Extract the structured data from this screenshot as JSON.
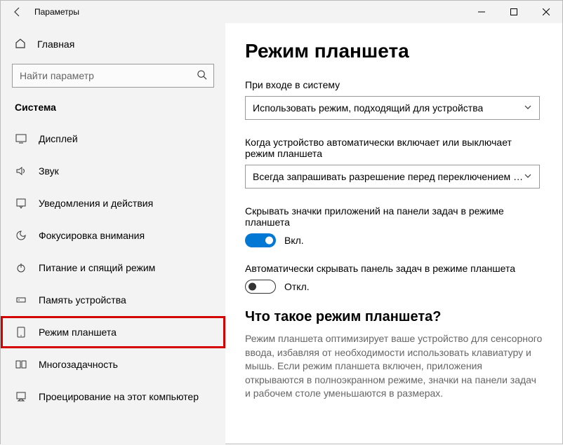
{
  "window": {
    "title": "Параметры"
  },
  "sidebar": {
    "home": "Главная",
    "search_placeholder": "Найти параметр",
    "section": "Система",
    "items": [
      {
        "icon": "display",
        "label": "Дисплей"
      },
      {
        "icon": "sound",
        "label": "Звук"
      },
      {
        "icon": "notifications",
        "label": "Уведомления и действия"
      },
      {
        "icon": "focus",
        "label": "Фокусировка внимания"
      },
      {
        "icon": "power",
        "label": "Питание и спящий режим"
      },
      {
        "icon": "storage",
        "label": "Память устройства"
      },
      {
        "icon": "tablet",
        "label": "Режим планшета",
        "highlighted": true
      },
      {
        "icon": "multitask",
        "label": "Многозадачность"
      },
      {
        "icon": "project",
        "label": "Проецирование на этот компьютер"
      }
    ]
  },
  "content": {
    "heading": "Режим планшета",
    "signin_label": "При входе в систему",
    "signin_value": "Использовать режим, подходящий для устройства",
    "auto_label": "Когда устройство автоматически включает или выключает режим планшета",
    "auto_value": "Всегда запрашивать разрешение перед переключением р...",
    "hide_icons_label": "Скрывать значки приложений на панели задач в режиме планшета",
    "hide_icons_state": "Вкл.",
    "auto_hide_label": "Автоматически скрывать панель задач в режиме планшета",
    "auto_hide_state": "Откл.",
    "what_heading": "Что такое режим планшета?",
    "what_body": "Режим планшета оптимизирует ваше устройство для сенсорного ввода, избавляя от необходимости использовать клавиатуру и мышь. Если режим планшета включен, приложения открываются в полноэкранном режиме, значки на панели задач и рабочем столе уменьшаются в размерах."
  }
}
